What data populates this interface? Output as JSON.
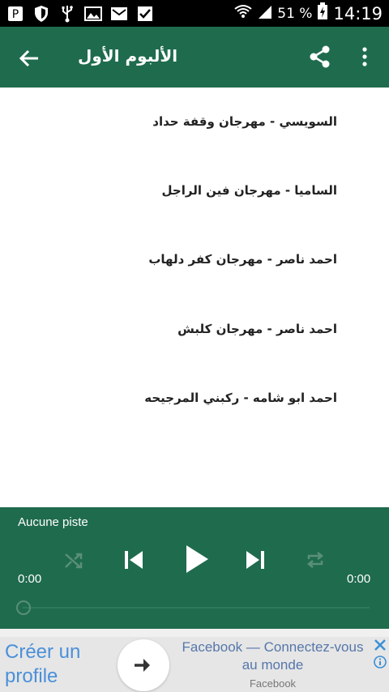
{
  "status_bar": {
    "battery_percent": "51 %",
    "time": "14:19"
  },
  "app_bar": {
    "title": "الألبوم الأول"
  },
  "tracks": [
    {
      "label": "السويسي - مهرجان وقفة حداد"
    },
    {
      "label": "الساميا - مهرجان فين الراجل"
    },
    {
      "label": "احمد ناصر - مهرجان كفر دلهاب"
    },
    {
      "label": "احمد ناصر - مهرجان كلبش"
    },
    {
      "label": "احمد ابو شامه - ركبني المرجيحه"
    }
  ],
  "player": {
    "track_name": "Aucune piste",
    "elapsed": "0:00",
    "duration": "0:00",
    "progress": 0
  },
  "ad": {
    "cta_line1": "Créer un",
    "cta_line2": "profile",
    "headline": "Facebook — Connectez-vous au monde",
    "brand": "Facebook"
  },
  "colors": {
    "primary": "#1f6b4e",
    "ad_cta": "#4a90d9"
  }
}
